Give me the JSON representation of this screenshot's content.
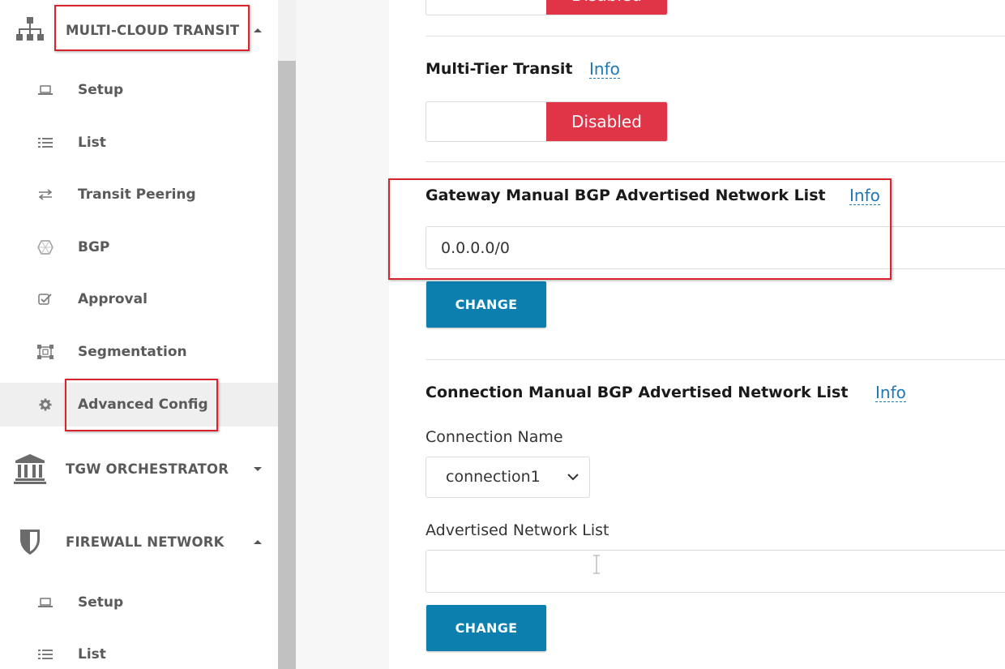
{
  "sidebar": {
    "sections": [
      {
        "label": "MULTI-CLOUD TRANSIT",
        "icon": "network-hierarchy-icon",
        "expanded": true
      },
      {
        "label": "TGW ORCHESTRATOR",
        "icon": "bank-building-icon",
        "expanded": false
      },
      {
        "label": "FIREWALL NETWORK",
        "icon": "shield-icon",
        "expanded": true
      }
    ],
    "transit_items": [
      {
        "label": "Setup",
        "icon": "laptop-icon"
      },
      {
        "label": "List",
        "icon": "list-icon"
      },
      {
        "label": "Transit Peering",
        "icon": "arrows-exchange-icon"
      },
      {
        "label": "BGP",
        "icon": "hexagon-icon"
      },
      {
        "label": "Approval",
        "icon": "checkbox-icon"
      },
      {
        "label": "Segmentation",
        "icon": "segmentation-icon"
      },
      {
        "label": "Advanced Config",
        "icon": "gear-icon",
        "active": true
      }
    ],
    "firewall_items": [
      {
        "label": "Setup",
        "icon": "laptop-icon"
      },
      {
        "label": "List",
        "icon": "list-icon"
      }
    ]
  },
  "main": {
    "top_toggle": {
      "state_label": "Disabled"
    },
    "multi_tier": {
      "title": "Multi-Tier Transit",
      "info": "Info",
      "state_label": "Disabled"
    },
    "gateway_bgp": {
      "title": "Gateway Manual BGP Advertised Network List",
      "info": "Info",
      "value": "0.0.0.0/0",
      "button": "CHANGE"
    },
    "connection_bgp": {
      "title": "Connection Manual BGP Advertised Network List",
      "info": "Info",
      "connection_label": "Connection Name",
      "connection_value": "connection1",
      "advertised_label": "Advertised Network List",
      "advertised_value": "",
      "button": "CHANGE"
    }
  },
  "colors": {
    "disabled_red": "#e03447",
    "button_blue": "#0c7fae",
    "info_link": "#1e78b4",
    "highlight": "#d9232d"
  }
}
